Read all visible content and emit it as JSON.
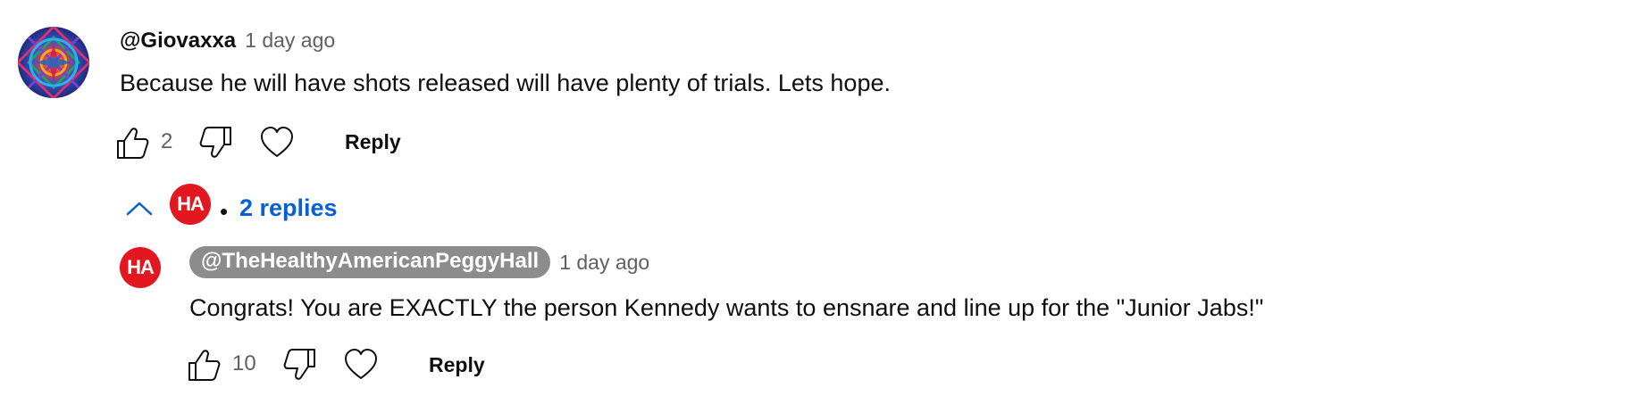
{
  "comment": {
    "author": "@Giovaxxa",
    "timestamp": "1 day ago",
    "text": "Because he will have shots released will have plenty of trials.  Lets hope.",
    "like_count": "2",
    "reply_label": "Reply",
    "avatar": "kaleidoscope-art-avatar"
  },
  "replies_toggle": {
    "avatar_text": "HA",
    "separator": "•",
    "label": "2 replies",
    "icon": "chevron-up-icon"
  },
  "reply": {
    "avatar_text": "HA",
    "author": "@TheHealthyAmericanPeggyHall",
    "timestamp": "1 day ago",
    "text": "Congrats! You are EXACTLY the person Kennedy wants to ensnare and line up for the \"Junior Jabs!\"",
    "like_count": "10",
    "reply_label": "Reply"
  },
  "colors": {
    "link_blue": "#065fd4",
    "secondary_text": "#606060",
    "ha_red": "#e3171f",
    "author_pill": "#8c8c8c"
  }
}
